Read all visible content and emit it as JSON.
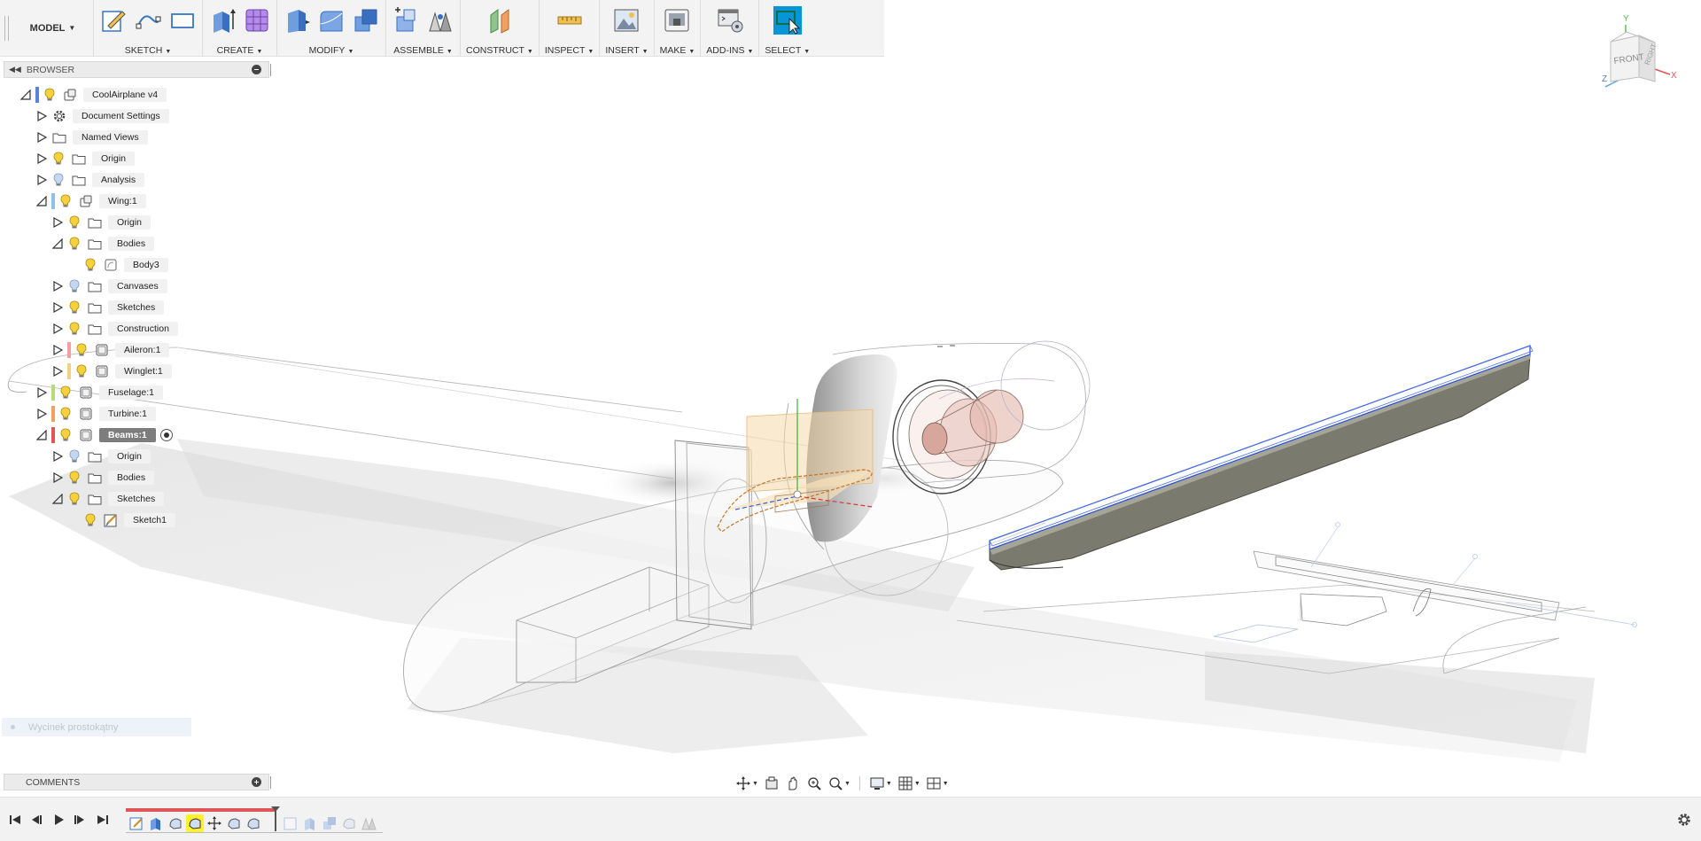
{
  "toolbar": {
    "workspace": "MODEL",
    "groups": [
      {
        "label": "SKETCH"
      },
      {
        "label": "CREATE"
      },
      {
        "label": "MODIFY"
      },
      {
        "label": "ASSEMBLE"
      },
      {
        "label": "CONSTRUCT"
      },
      {
        "label": "INSPECT"
      },
      {
        "label": "INSERT"
      },
      {
        "label": "MAKE"
      },
      {
        "label": "ADD-INS"
      },
      {
        "label": "SELECT"
      }
    ]
  },
  "browser": {
    "title": "BROWSER",
    "tree": [
      {
        "label": "CoolAirplane v4",
        "expanded": true,
        "icon": "component-icon",
        "strip": "#5a84d8"
      },
      {
        "label": "Document Settings",
        "expanded": false,
        "icon": "gear-icon"
      },
      {
        "label": "Named Views",
        "expanded": false,
        "icon": "folder-icon"
      },
      {
        "label": "Origin",
        "expanded": false,
        "icon": "folder-icon"
      },
      {
        "label": "Analysis",
        "expanded": false,
        "icon": "folder-icon"
      },
      {
        "label": "Wing:1",
        "expanded": true,
        "icon": "component-icon",
        "strip": "#8ec1e8"
      },
      {
        "label": "Origin",
        "expanded": false,
        "icon": "folder-icon"
      },
      {
        "label": "Bodies",
        "expanded": true,
        "icon": "folder-icon"
      },
      {
        "label": "Body3",
        "icon": "body-icon"
      },
      {
        "label": "Canvases",
        "expanded": false,
        "icon": "folder-icon"
      },
      {
        "label": "Sketches",
        "expanded": false,
        "icon": "folder-icon"
      },
      {
        "label": "Construction",
        "expanded": false,
        "icon": "folder-icon"
      },
      {
        "label": "Aileron:1",
        "expanded": false,
        "icon": "occurrence-icon",
        "strip": "#f0a0a0"
      },
      {
        "label": "Winglet:1",
        "expanded": false,
        "icon": "occurrence-icon",
        "strip": "#f3d088"
      },
      {
        "label": "Fuselage:1",
        "expanded": false,
        "icon": "occurrence-icon",
        "strip": "#b6dc7a"
      },
      {
        "label": "Turbine:1",
        "expanded": false,
        "icon": "occurrence-icon",
        "strip": "#f0a060"
      },
      {
        "label": "Beams:1",
        "expanded": true,
        "icon": "occurrence-icon",
        "strip": "#e05555",
        "active": true
      },
      {
        "label": "Origin",
        "expanded": false,
        "icon": "folder-icon"
      },
      {
        "label": "Bodies",
        "expanded": false,
        "icon": "folder-icon"
      },
      {
        "label": "Sketches",
        "expanded": true,
        "icon": "folder-icon"
      },
      {
        "label": "Sketch1",
        "icon": "sketch-icon"
      }
    ]
  },
  "hint": "Wycinek prostokątny",
  "comments": {
    "title": "COMMENTS"
  },
  "viewcube": {
    "front": "FRONT",
    "right": "RIGHT",
    "axis_x": "X",
    "axis_y": "Y",
    "axis_z": "Z"
  },
  "colors": {
    "accent": "#0696d7",
    "active_item": "#7d7d7d",
    "timeline_red": "#e05555",
    "highlight": "#fff22a"
  }
}
